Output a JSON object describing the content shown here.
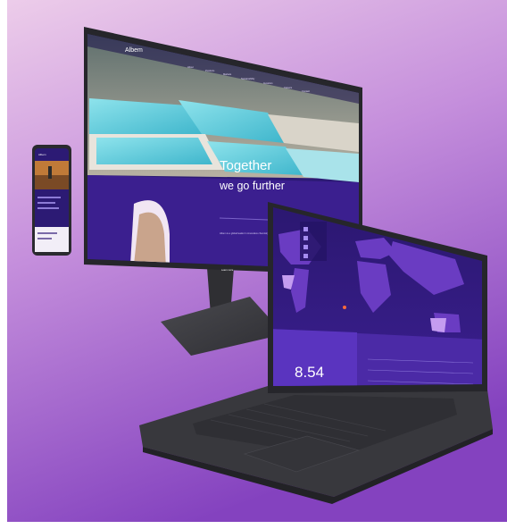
{
  "monitor": {
    "logo": "Albem",
    "nav": [
      "About",
      "Products",
      "Markets",
      "Sustainability",
      "Investors",
      "Careers",
      "Contact"
    ],
    "hero": {
      "line1": "Together",
      "line2": "we go further"
    },
    "section_text": "Albem is a global leader in innovative chemistry, creating solutions for a more resilient world.",
    "cta": "Learn more"
  },
  "phone": {
    "title": "Albem"
  },
  "laptop": {
    "stat_value": "8.54"
  },
  "colors": {
    "background_top": "#e9c3e6",
    "background_bottom": "#8e4cc0",
    "device_body": "#3a3a3e",
    "screen_purple": "#3b1f8f",
    "map_land": "#6a3cc2",
    "pool_water": "#6fd3e0"
  }
}
